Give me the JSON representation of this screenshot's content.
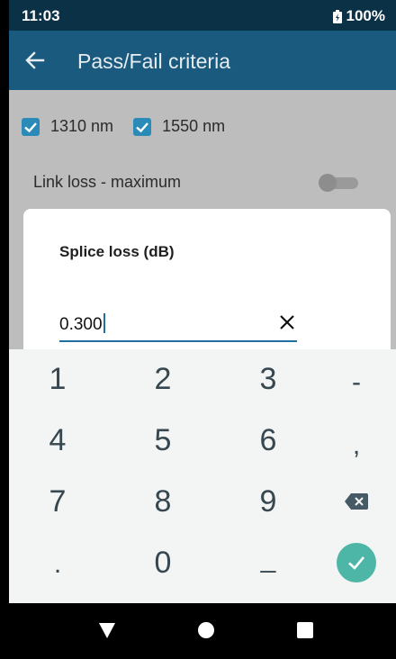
{
  "status_bar": {
    "time": "11:03",
    "battery": "100%"
  },
  "app_bar": {
    "title": "Pass/Fail criteria"
  },
  "background": {
    "wavelengths": [
      {
        "label": "1310 nm",
        "checked": true
      },
      {
        "label": "1550 nm",
        "checked": true
      }
    ],
    "link_loss_label": "Link loss - maximum",
    "link_loss_enabled": false
  },
  "dialog": {
    "title": "Splice loss (dB)",
    "input_value": "0.300"
  },
  "keypad": {
    "keys": [
      "1",
      "2",
      "3",
      "-",
      "4",
      "5",
      "6",
      ",",
      "7",
      "8",
      "9",
      ".",
      "0",
      "_"
    ]
  },
  "colors": {
    "app_bar": "#1a5a7e",
    "status_bar": "#0b3147",
    "accent": "#1f6fa0",
    "enter": "#4db6a6"
  },
  "icons": [
    "back-arrow-icon",
    "battery-icon",
    "check-icon",
    "clear-icon",
    "backspace-icon",
    "enter-check-icon",
    "nav-back-icon",
    "nav-home-icon",
    "nav-recents-icon"
  ]
}
